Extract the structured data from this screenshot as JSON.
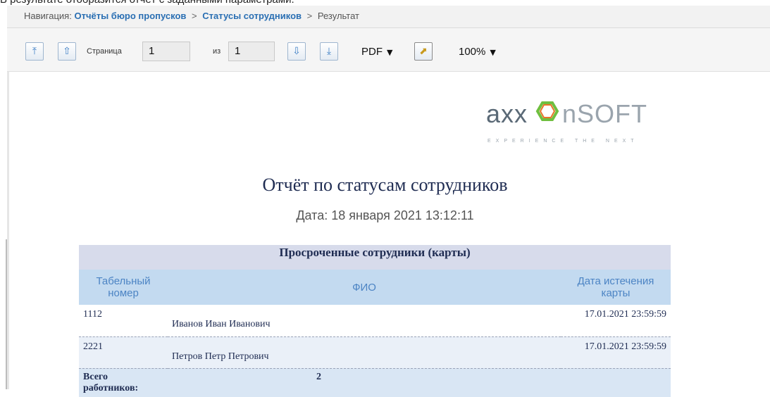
{
  "caption": "В результате отобразится отчёт с заданными параметрами.",
  "navigation": {
    "label": "Навигация:",
    "crumbs": [
      "Отчёты бюро пропусков",
      "Статусы сотрудников"
    ],
    "current": "Результат",
    "separator": ">"
  },
  "toolbar": {
    "first_icon": "first-page-icon",
    "prev_icon": "previous-page-icon",
    "page_label": "Страница",
    "page_value": "1",
    "of_label": "из",
    "total_pages": "1",
    "next_icon": "next-page-icon",
    "last_icon": "last-page-icon",
    "format_value": "PDF",
    "export_icon": "export-icon",
    "zoom_value": "100%"
  },
  "logo": {
    "main": "axx",
    "mid": "nsoft",
    "tagline": "EXPERIENCE THE NEXT"
  },
  "report": {
    "title": "Отчёт по статусам сотрудников",
    "date": "Дата: 18 января 2021 13:12:11",
    "section_title": "Просроченные сотрудники (карты)",
    "columns": [
      "Табельный номер",
      "ФИО",
      "Дата истечения карты"
    ],
    "rows": [
      {
        "id": "1112",
        "name": "Иванов Иван Иванович",
        "expiry": "17.01.2021 23:59:59"
      },
      {
        "id": "2221",
        "name": "Петров Петр Петрович",
        "expiry": "17.01.2021 23:59:59"
      }
    ],
    "total_label": "Всего работников:",
    "total_value": "2"
  }
}
